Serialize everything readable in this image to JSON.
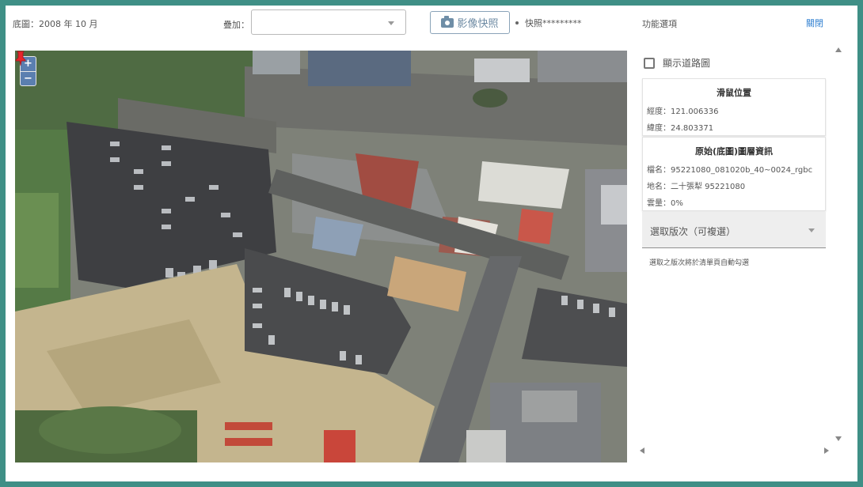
{
  "toolbar": {
    "basemap_label": "底圖：2008 年 10 月",
    "overlay_label": "疊加：",
    "overlay_value": "",
    "snapshot_button": "影像快照",
    "snapshot_status": "快照*********",
    "function_options": "功能選項",
    "close": "關閉"
  },
  "map": {
    "zoom_in": "+",
    "zoom_out": "−"
  },
  "panel": {
    "show_road_map": "顯示道路圖",
    "mouse_position": {
      "title": "滑鼠位置",
      "longitude": "經度：121.006336",
      "latitude": "緯度：24.803371"
    },
    "layer_info": {
      "title": "原始(底圖)圖層資訊",
      "file_name": "檔名：95221080_081020b_40~0024_rgbc",
      "map_name": "地名：二十張犁 95221080",
      "cloud_cover": "雲量：0%"
    },
    "edition_select": "選取版次（可複選）",
    "edition_hint": "選取之版次將於清單頁自動勾選"
  },
  "colors": {
    "frame": "#3f8f86",
    "link": "#2f7fd0",
    "button_text": "#6d8aa3",
    "pin": "#e8262b"
  }
}
